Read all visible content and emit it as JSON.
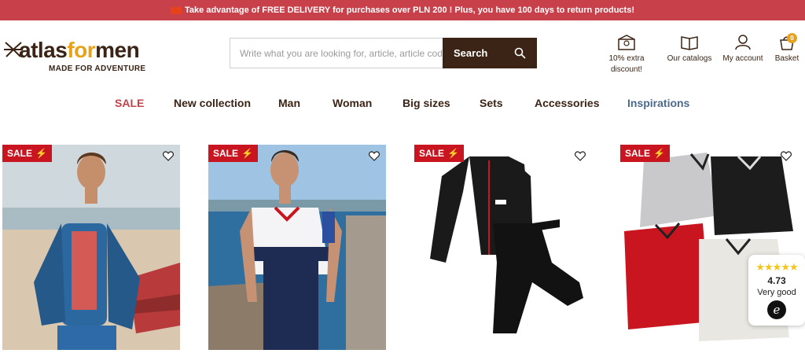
{
  "banner": {
    "text": "Take advantage of FREE DELIVERY for purchases over PLN 200 ! Plus, you have 100 days to return products!",
    "icon": "truck-icon"
  },
  "logo": {
    "part1": "atlas",
    "part2": "for",
    "part3": "men",
    "tagline": "MADE FOR ADVENTURE"
  },
  "search": {
    "placeholder": "Write what you are looking for, article, article code",
    "button_label": "Search"
  },
  "header_icons": {
    "discount": {
      "line1": "10% extra",
      "line2": "discount!"
    },
    "catalogs": {
      "label": "Our catalogs"
    },
    "account": {
      "label": "My account"
    },
    "basket": {
      "label": "Basket",
      "count": "0"
    }
  },
  "nav": [
    {
      "label": "SALE"
    },
    {
      "label": "New collection"
    },
    {
      "label": "Man"
    },
    {
      "label": "Woman"
    },
    {
      "label": "Big sizes"
    },
    {
      "label": "Sets"
    },
    {
      "label": "Accessories"
    },
    {
      "label": "Inspirations"
    }
  ],
  "products": [
    {
      "tag": "SALE"
    },
    {
      "tag": "SALE"
    },
    {
      "tag": "SALE"
    },
    {
      "tag": "SALE"
    }
  ],
  "rating": {
    "stars": "★★★★★",
    "score": "4.73",
    "label": "Very good",
    "logo": "e"
  },
  "colors": {
    "banner": "#c8414a",
    "brand_brown": "#3b2415",
    "accent_orange": "#e8a21a",
    "sale_red": "#c8151f",
    "inspirations_blue": "#4b6a8d"
  }
}
